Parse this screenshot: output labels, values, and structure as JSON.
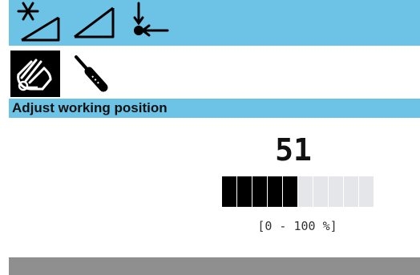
{
  "toolbar": {
    "background": "#6cc3e6",
    "icons": [
      "star-slope-icon",
      "slope-triangle-icon",
      "point-arrow-icon"
    ]
  },
  "modes": {
    "items": [
      {
        "icon": "hand-icon",
        "active": true
      },
      {
        "icon": "screwdriver-icon",
        "active": false
      }
    ]
  },
  "header": {
    "title": "Adjust working position",
    "background": "#6cc3e6"
  },
  "adjust": {
    "value": "51",
    "level_fraction": 0.51,
    "segments_total": 10,
    "segments_filled": 5,
    "range_label": "[0 - 100 %]",
    "filled_color": "#000000",
    "empty_color": "#e4e6ea"
  },
  "footer": {
    "background": "#8f8f8f"
  }
}
